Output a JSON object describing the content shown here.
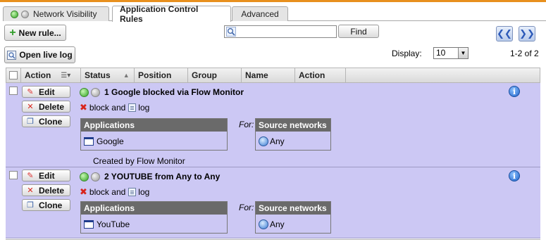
{
  "tabs": [
    {
      "label": "Network Visibility",
      "status_leds": [
        "green",
        "grey"
      ]
    },
    {
      "label": "Application Control Rules",
      "active": true
    },
    {
      "label": "Advanced"
    }
  ],
  "toolbar": {
    "new_rule_label": "New rule...",
    "open_live_log_label": "Open live log",
    "search_placeholder": "",
    "find_label": "Find",
    "prev_icon": "double-chevron-left-icon",
    "next_icon": "double-chevron-right-icon"
  },
  "pagination": {
    "display_label": "Display:",
    "display_value": "10",
    "page_info": "1-2 of 2"
  },
  "table": {
    "columns": [
      "Action",
      "Status",
      "Position",
      "Group",
      "Name",
      "Action"
    ]
  },
  "row_actions": {
    "edit": "Edit",
    "delete": "Delete",
    "clone": "Clone"
  },
  "rules": [
    {
      "title": "1 Google blocked via Flow Monitor",
      "action_block": "block",
      "action_and": "and",
      "action_log": "log",
      "applications_header": "Applications",
      "application": "Google",
      "for_label": "For:",
      "source_header": "Source networks",
      "source": "Any",
      "note": "Created by Flow Monitor"
    },
    {
      "title": "2 YOUTUBE from Any to Any",
      "action_block": "block",
      "action_and": "and",
      "action_log": "log",
      "applications_header": "Applications",
      "application": "YouTube",
      "for_label": "For:",
      "source_header": "Source networks",
      "source": "Any"
    }
  ],
  "colors": {
    "row_background": "#ccc8f4",
    "box_header": "#6a6a6a",
    "accent_line": "#e8901e"
  }
}
